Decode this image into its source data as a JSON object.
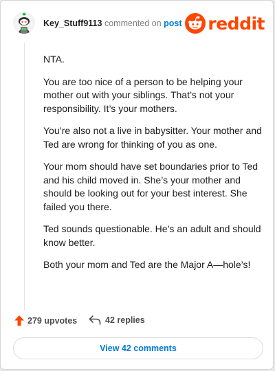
{
  "comment": {
    "username": "Key_Stuff9113",
    "action_text": "commented on",
    "post_link": "post",
    "paragraphs": [
      "NTA.",
      "You are too nice of a person to be helping your mother out with your siblings. That’s not your responsibility. It’s your mothers.",
      "You’re also not a live in babysitter. Your mother and Ted are wrong for thinking of you as one.",
      "Your mom should have set boundaries prior to Ted and his child moved in. She’s your mother and should be looking out for your best interest. She failed you there.",
      "Ted sounds questionable. He’s an adult and should know better.",
      "Both your mom and Ted are the Major A—hole’s!"
    ],
    "upvotes": "279 upvotes",
    "replies": "42 replies",
    "view_comments": "View 42 comments"
  },
  "brand": {
    "logo_text": "reddit",
    "color": "#ff4500",
    "link_color": "#0079d3"
  },
  "icons": [
    "avatar",
    "reddit-logo-icon",
    "upvote-arrow-icon",
    "reply-arrow-icon"
  ]
}
